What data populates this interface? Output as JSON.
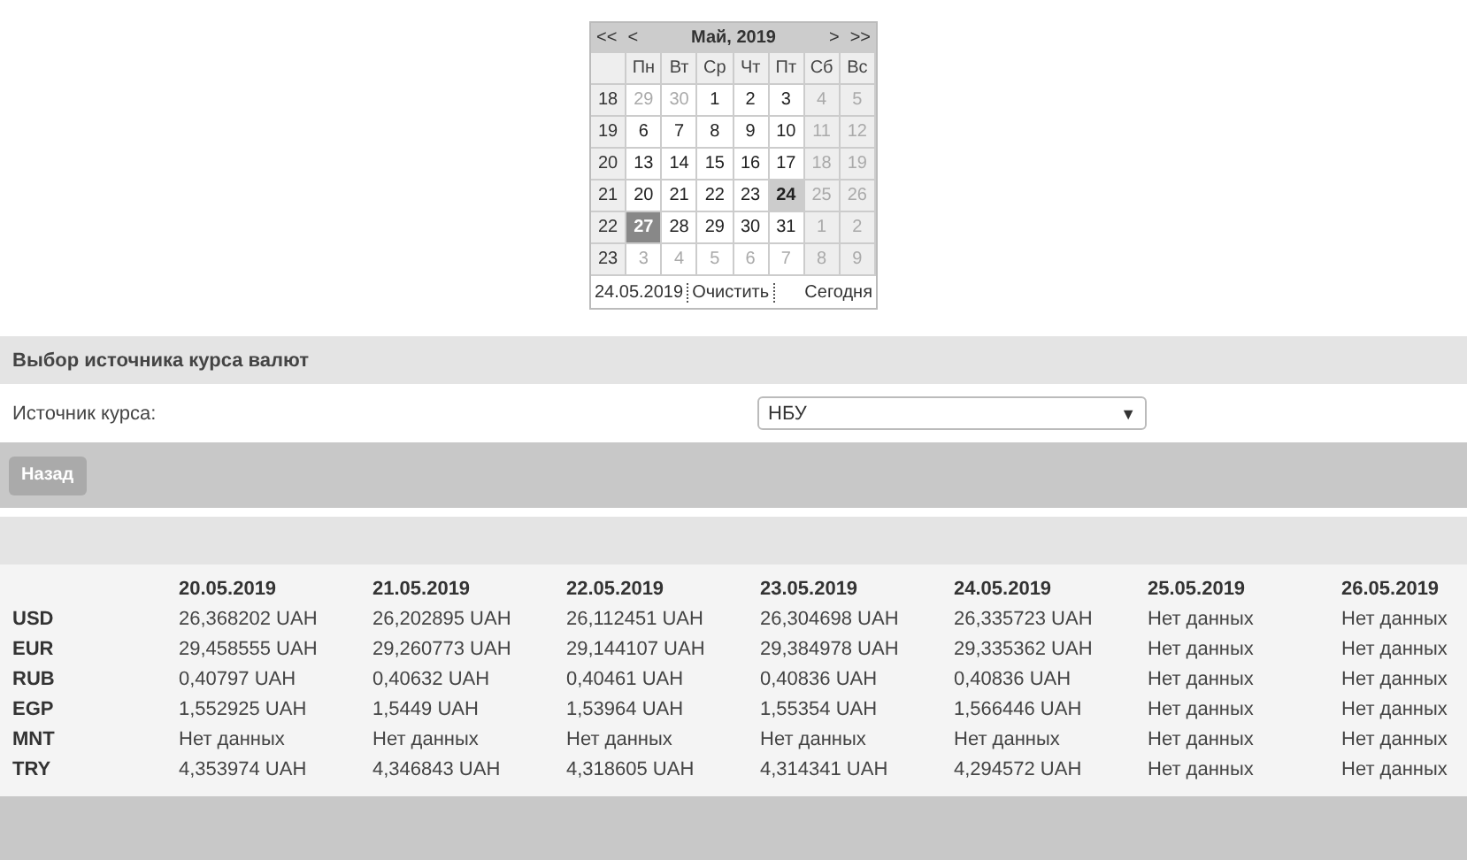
{
  "calendar": {
    "nav": [
      "<<",
      "<",
      ">",
      ">>"
    ],
    "title": "Май, 2019",
    "weekdays": [
      "Пн",
      "Вт",
      "Ср",
      "Чт",
      "Пт",
      "Сб",
      "Вс"
    ],
    "weeks": [
      {
        "number": "18",
        "days": [
          {
            "label": "29",
            "muted": true,
            "selected": false,
            "today": false
          },
          {
            "label": "30",
            "muted": true,
            "selected": false,
            "today": false
          },
          {
            "label": "1",
            "muted": false,
            "selected": false,
            "today": false
          },
          {
            "label": "2",
            "muted": false,
            "selected": false,
            "today": false
          },
          {
            "label": "3",
            "muted": false,
            "selected": false,
            "today": false
          },
          {
            "label": "4",
            "muted": true,
            "selected": false,
            "today": false
          },
          {
            "label": "5",
            "muted": true,
            "selected": false,
            "today": false
          }
        ]
      },
      {
        "number": "19",
        "days": [
          {
            "label": "6",
            "muted": false,
            "selected": false,
            "today": false
          },
          {
            "label": "7",
            "muted": false,
            "selected": false,
            "today": false
          },
          {
            "label": "8",
            "muted": false,
            "selected": false,
            "today": false
          },
          {
            "label": "9",
            "muted": false,
            "selected": false,
            "today": false
          },
          {
            "label": "10",
            "muted": false,
            "selected": false,
            "today": false
          },
          {
            "label": "11",
            "muted": true,
            "selected": false,
            "today": false
          },
          {
            "label": "12",
            "muted": true,
            "selected": false,
            "today": false
          }
        ]
      },
      {
        "number": "20",
        "days": [
          {
            "label": "13",
            "muted": false,
            "selected": false,
            "today": false
          },
          {
            "label": "14",
            "muted": false,
            "selected": false,
            "today": false
          },
          {
            "label": "15",
            "muted": false,
            "selected": false,
            "today": false
          },
          {
            "label": "16",
            "muted": false,
            "selected": false,
            "today": false
          },
          {
            "label": "17",
            "muted": false,
            "selected": false,
            "today": false
          },
          {
            "label": "18",
            "muted": true,
            "selected": false,
            "today": false
          },
          {
            "label": "19",
            "muted": true,
            "selected": false,
            "today": false
          }
        ]
      },
      {
        "number": "21",
        "days": [
          {
            "label": "20",
            "muted": false,
            "selected": false,
            "today": false
          },
          {
            "label": "21",
            "muted": false,
            "selected": false,
            "today": false
          },
          {
            "label": "22",
            "muted": false,
            "selected": false,
            "today": false
          },
          {
            "label": "23",
            "muted": false,
            "selected": false,
            "today": false
          },
          {
            "label": "24",
            "muted": false,
            "selected": true,
            "today": false
          },
          {
            "label": "25",
            "muted": true,
            "selected": false,
            "today": false
          },
          {
            "label": "26",
            "muted": true,
            "selected": false,
            "today": false
          }
        ]
      },
      {
        "number": "22",
        "days": [
          {
            "label": "27",
            "muted": false,
            "selected": false,
            "today": true
          },
          {
            "label": "28",
            "muted": false,
            "selected": false,
            "today": false
          },
          {
            "label": "29",
            "muted": false,
            "selected": false,
            "today": false
          },
          {
            "label": "30",
            "muted": false,
            "selected": false,
            "today": false
          },
          {
            "label": "31",
            "muted": false,
            "selected": false,
            "today": false
          },
          {
            "label": "1",
            "muted": true,
            "selected": false,
            "today": false
          },
          {
            "label": "2",
            "muted": true,
            "selected": false,
            "today": false
          }
        ]
      },
      {
        "number": "23",
        "days": [
          {
            "label": "3",
            "muted": true,
            "selected": false,
            "today": false
          },
          {
            "label": "4",
            "muted": true,
            "selected": false,
            "today": false
          },
          {
            "label": "5",
            "muted": true,
            "selected": false,
            "today": false
          },
          {
            "label": "6",
            "muted": true,
            "selected": false,
            "today": false
          },
          {
            "label": "7",
            "muted": true,
            "selected": false,
            "today": false
          },
          {
            "label": "8",
            "muted": true,
            "selected": false,
            "today": false
          },
          {
            "label": "9",
            "muted": true,
            "selected": false,
            "today": false
          }
        ]
      }
    ],
    "footer": {
      "date": "24.05.2019",
      "clear": "Очистить",
      "today": "Сегодня"
    }
  },
  "source_section": {
    "title": "Выбор источника курса валют",
    "label": "Источник курса:",
    "select": {
      "value": "НБУ",
      "arrow": "▼"
    }
  },
  "back_button": "Назад",
  "rates_table": {
    "columns": [
      "20.05.2019",
      "21.05.2019",
      "22.05.2019",
      "23.05.2019",
      "24.05.2019",
      "25.05.2019",
      "26.05.2019"
    ],
    "rows": [
      {
        "currency": "USD",
        "values": [
          "26,368202 UAH",
          "26,202895 UAH",
          "26,112451 UAH",
          "26,304698 UAH",
          "26,335723 UAH",
          "Нет данных",
          "Нет данных"
        ]
      },
      {
        "currency": "EUR",
        "values": [
          "29,458555 UAH",
          "29,260773 UAH",
          "29,144107 UAH",
          "29,384978 UAH",
          "29,335362 UAH",
          "Нет данных",
          "Нет данных"
        ]
      },
      {
        "currency": "RUB",
        "values": [
          "0,40797 UAH",
          "0,40632 UAH",
          "0,40461 UAH",
          "0,40836 UAH",
          "0,40836 UAH",
          "Нет данных",
          "Нет данных"
        ]
      },
      {
        "currency": "EGP",
        "values": [
          "1,552925 UAH",
          "1,5449 UAH",
          "1,53964 UAH",
          "1,55354 UAH",
          "1,566446 UAH",
          "Нет данных",
          "Нет данных"
        ]
      },
      {
        "currency": "MNT",
        "values": [
          "Нет данных",
          "Нет данных",
          "Нет данных",
          "Нет данных",
          "Нет данных",
          "Нет данных",
          "Нет данных"
        ]
      },
      {
        "currency": "TRY",
        "values": [
          "4,353974 UAH",
          "4,346843 UAH",
          "4,318605 UAH",
          "4,314341 UAH",
          "4,294572 UAH",
          "Нет данных",
          "Нет данных"
        ]
      }
    ]
  }
}
